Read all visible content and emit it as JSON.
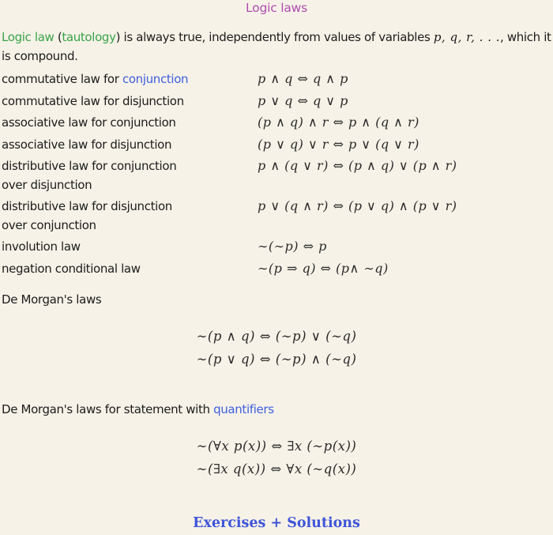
{
  "title": "Logic laws",
  "intro": {
    "term": "Logic law",
    "paren_open": " (",
    "synonym": "tautology",
    "paren_close": ")",
    "text": " is always true, independently from values of variables ",
    "variables": "p,  q,  r, . . .",
    "text_end": ", which it is compound."
  },
  "laws": [
    {
      "label_pre": "commutative law for ",
      "label_link": "conjunction",
      "label_post": "",
      "formula": "p ∧ q ⇔ q ∧ p"
    },
    {
      "label_pre": "commutative law for disjunction",
      "label_link": "",
      "label_post": "",
      "formula": "p ∨ q ⇔ q ∨ p"
    },
    {
      "label_pre": "associative law for conjunction",
      "label_link": "",
      "label_post": "",
      "formula": "(p ∧ q) ∧ r ⇔ p ∧ (q ∧ r)"
    },
    {
      "label_pre": "associative law for disjunction",
      "label_link": "",
      "label_post": "",
      "formula": "(p ∨ q) ∨ r ⇔ p ∨ (q ∨ r)"
    },
    {
      "label_pre": "distributive law for conjunction",
      "label_link": "",
      "label_post": "over disjunction",
      "formula": "p ∧ (q ∨ r) ⇔ (p ∧ q) ∨ (p ∧ r)"
    },
    {
      "label_pre": "distributive law for disjunction",
      "label_link": "",
      "label_post": "over conjunction",
      "formula": "p ∨ (q ∧ r) ⇔ (p ∨ q) ∧ (p ∨ r)"
    },
    {
      "label_pre": "involution law",
      "label_link": "",
      "label_post": "",
      "formula": "∼(∼p) ⇔ p"
    },
    {
      "label_pre": "negation conditional law",
      "label_link": "",
      "label_post": "",
      "formula": "∼(p ⇒ q) ⇔ (p∧ ∼q)"
    }
  ],
  "de_morgan": {
    "heading": "De Morgan's laws",
    "formulas": [
      "∼(p ∧ q) ⇔ (∼p) ∨ (∼q)",
      "∼(p ∨ q) ⇔ (∼p) ∧ (∼q)"
    ]
  },
  "de_morgan_quantifiers": {
    "heading_pre": "De Morgan's laws for statement with ",
    "heading_link": "quantifiers",
    "formulas": [
      "∼(∀x p(x)) ⇔ ∃x (∼p(x))",
      "∼(∃x q(x)) ⇔ ∀x (∼q(x))"
    ]
  },
  "exercises_link": "Exercises + Solutions",
  "colors": {
    "background": "#f6f2e7",
    "title": "#b04bb0",
    "term_green": "#3aa34a",
    "link_blue": "#3f5fe0",
    "exercises_blue": "#3f55d9"
  }
}
